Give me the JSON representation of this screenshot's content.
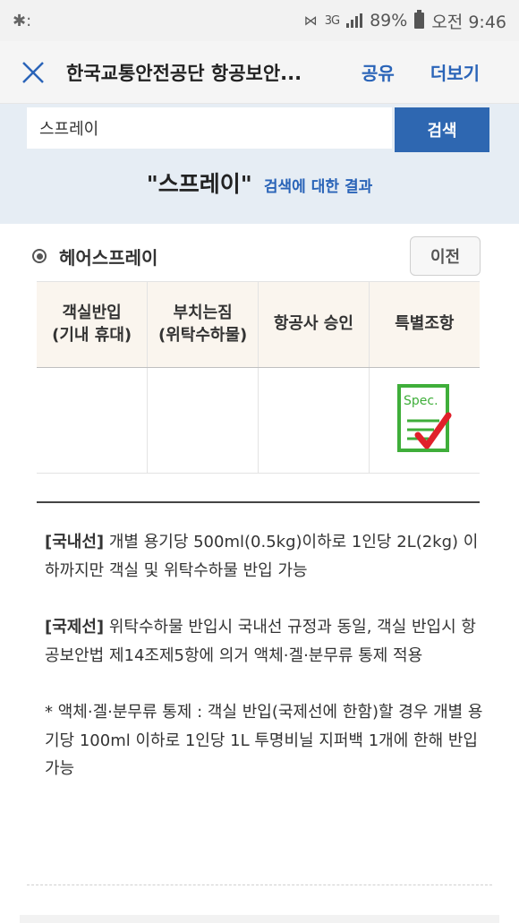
{
  "status_bar": {
    "network": "3G",
    "battery": "89%",
    "time": "오전 9:46"
  },
  "app_bar": {
    "title": "한국교통안전공단 항공보안...",
    "share_label": "공유",
    "more_label": "더보기"
  },
  "search": {
    "value": "스프레이",
    "button_label": "검색",
    "result_query": "\"스프레이\"",
    "result_suffix": "검색에 대한 결과"
  },
  "item": {
    "name": "헤어스프레이",
    "prev_label": "이전"
  },
  "table": {
    "headers": [
      {
        "line1": "객실반입",
        "line2": "(기내 휴대)"
      },
      {
        "line1": "부치는짐",
        "line2": "(위탁수하물)"
      },
      {
        "line1": "항공사 승인",
        "line2": ""
      },
      {
        "line1": "특별조항",
        "line2": ""
      }
    ],
    "spec_icon_text": "Spec."
  },
  "notes": {
    "domestic_tag": "[국내선]",
    "domestic_text": " 개별 용기당 500ml(0.5kg)이하로 1인당 2L(2kg) 이하까지만 객실 및 위탁수하물 반입 가능",
    "intl_tag": "[국제선]",
    "intl_text": " 위탁수하물 반입시 국내선 규정과 동일, 객실 반입시 항공보안법 제14조제5항에 의거 액체·겔·분무류 통제 적용",
    "lag_text": "* 액체·겔·분무류 통제 : 객실 반입(국제선에 한함)할 경우 개별 용기당 100ml 이하로 1인당 1L 투명비닐 지퍼백 1개에 한해 반입 가능"
  },
  "colors": {
    "accent": "#2a64b8",
    "search_button": "#2e67b1",
    "panel": "#e6edf4",
    "check": "#e0202a",
    "spec_green": "#3fae3a"
  }
}
